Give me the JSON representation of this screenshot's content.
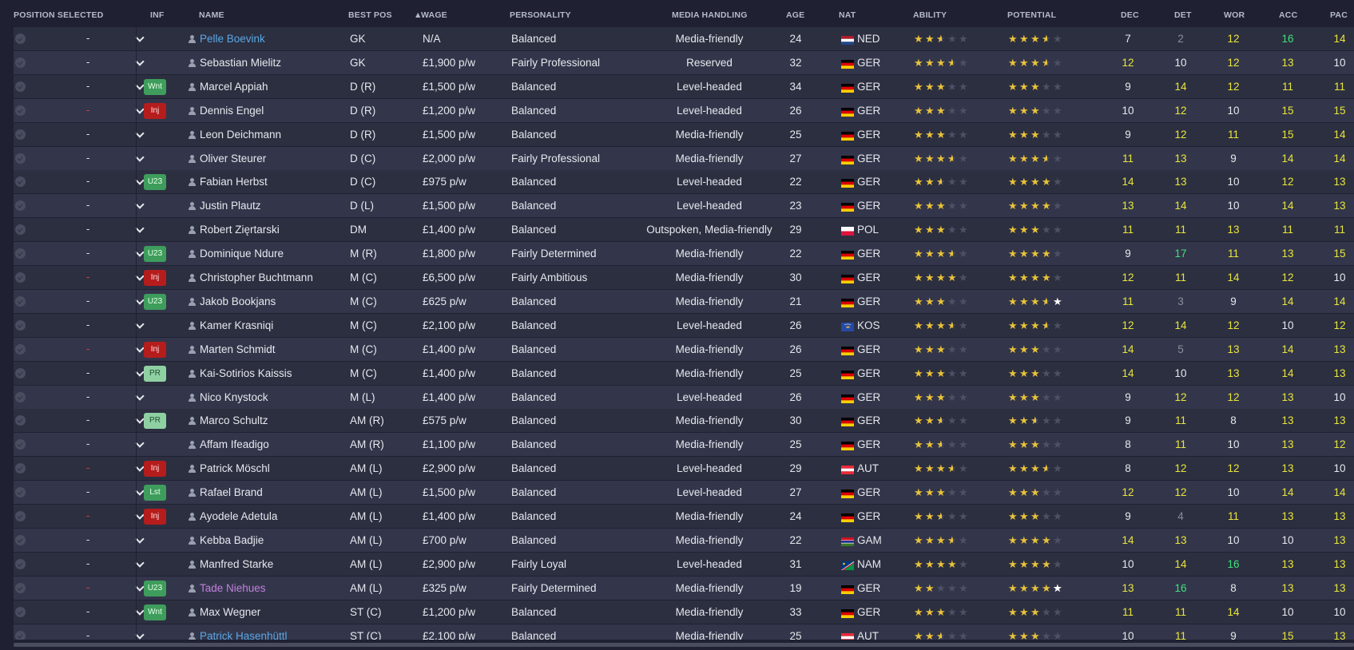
{
  "columns": {
    "position_selected": "POSITION SELECTED",
    "inf": "INF",
    "name": "NAME",
    "best_pos": "BEST POS",
    "wage": "WAGE",
    "personality": "PERSONALITY",
    "media_handling": "MEDIA HANDLING",
    "age": "AGE",
    "nat": "NAT",
    "ability": "ABILITY",
    "potential": "POTENTIAL",
    "dec": "DEC",
    "det": "DET",
    "wor": "WOR",
    "acc": "ACC",
    "pac": "PAC"
  },
  "sort_indicator": "▲",
  "colors": {
    "attr_white": "#e6e8ee",
    "attr_yellow": "#e8e63a",
    "attr_green": "#3fe07a",
    "attr_grey": "#8a8e9c",
    "star_gold": "#e8c23a",
    "star_empty": "#4e5163"
  },
  "players": [
    {
      "pos_sel": "-",
      "pos_red": false,
      "inf": "",
      "inf_type": "",
      "name": "Pelle Boevink",
      "name_color": "blue",
      "best_pos": "GK",
      "wage": "N/A",
      "personality": "Balanced",
      "media": "Media-friendly",
      "age": "24",
      "nat": "NED",
      "flag": "NED",
      "ability": 2.5,
      "potential": 3.5,
      "dec": "7",
      "dec_c": "white",
      "det": "2",
      "det_c": "grey",
      "wor": "12",
      "wor_c": "yellow",
      "acc": "16",
      "acc_c": "green",
      "pac": "14",
      "pac_c": "yellow"
    },
    {
      "pos_sel": "-",
      "pos_red": false,
      "inf": "",
      "inf_type": "",
      "name": "Sebastian Mielitz",
      "name_color": "white",
      "best_pos": "GK",
      "wage": "£1,900 p/w",
      "personality": "Fairly Professional",
      "media": "Reserved",
      "age": "32",
      "nat": "GER",
      "flag": "GER",
      "ability": 3.5,
      "potential": 3.5,
      "dec": "12",
      "dec_c": "yellow",
      "det": "10",
      "det_c": "white",
      "wor": "12",
      "wor_c": "yellow",
      "acc": "13",
      "acc_c": "yellow",
      "pac": "10",
      "pac_c": "white"
    },
    {
      "pos_sel": "-",
      "pos_red": false,
      "inf": "Wnt",
      "inf_type": "green",
      "name": "Marcel Appiah",
      "name_color": "white",
      "best_pos": "D (R)",
      "wage": "£1,500 p/w",
      "personality": "Balanced",
      "media": "Level-headed",
      "age": "34",
      "nat": "GER",
      "flag": "GER",
      "ability": 3,
      "potential": 3,
      "dec": "9",
      "dec_c": "white",
      "det": "14",
      "det_c": "yellow",
      "wor": "12",
      "wor_c": "yellow",
      "acc": "11",
      "acc_c": "yellow",
      "pac": "11",
      "pac_c": "yellow"
    },
    {
      "pos_sel": "-",
      "pos_red": true,
      "inf": "Inj",
      "inf_type": "red",
      "name": "Dennis Engel",
      "name_color": "white",
      "best_pos": "D (R)",
      "wage": "£1,200 p/w",
      "personality": "Balanced",
      "media": "Level-headed",
      "age": "26",
      "nat": "GER",
      "flag": "GER",
      "ability": 3,
      "potential": 3,
      "dec": "10",
      "dec_c": "white",
      "det": "12",
      "det_c": "yellow",
      "wor": "10",
      "wor_c": "white",
      "acc": "15",
      "acc_c": "yellow",
      "pac": "15",
      "pac_c": "yellow"
    },
    {
      "pos_sel": "-",
      "pos_red": false,
      "inf": "",
      "inf_type": "",
      "name": "Leon Deichmann",
      "name_color": "white",
      "best_pos": "D (R)",
      "wage": "£1,500 p/w",
      "personality": "Balanced",
      "media": "Media-friendly",
      "age": "25",
      "nat": "GER",
      "flag": "GER",
      "ability": 3,
      "potential": 3,
      "dec": "9",
      "dec_c": "white",
      "det": "12",
      "det_c": "yellow",
      "wor": "11",
      "wor_c": "yellow",
      "acc": "15",
      "acc_c": "yellow",
      "pac": "14",
      "pac_c": "yellow"
    },
    {
      "pos_sel": "-",
      "pos_red": false,
      "inf": "",
      "inf_type": "",
      "name": "Oliver Steurer",
      "name_color": "white",
      "best_pos": "D (C)",
      "wage": "£2,000 p/w",
      "personality": "Fairly Professional",
      "media": "Media-friendly",
      "age": "27",
      "nat": "GER",
      "flag": "GER",
      "ability": 3.5,
      "potential": 3.5,
      "dec": "11",
      "dec_c": "yellow",
      "det": "13",
      "det_c": "yellow",
      "wor": "9",
      "wor_c": "white",
      "acc": "14",
      "acc_c": "yellow",
      "pac": "14",
      "pac_c": "yellow"
    },
    {
      "pos_sel": "-",
      "pos_red": false,
      "inf": "U23",
      "inf_type": "green",
      "name": "Fabian Herbst",
      "name_color": "white",
      "best_pos": "D (C)",
      "wage": "£975 p/w",
      "personality": "Balanced",
      "media": "Level-headed",
      "age": "22",
      "nat": "GER",
      "flag": "GER",
      "ability": 2.5,
      "potential": 4,
      "dec": "14",
      "dec_c": "yellow",
      "det": "13",
      "det_c": "yellow",
      "wor": "10",
      "wor_c": "white",
      "acc": "12",
      "acc_c": "yellow",
      "pac": "13",
      "pac_c": "yellow"
    },
    {
      "pos_sel": "-",
      "pos_red": false,
      "inf": "",
      "inf_type": "",
      "name": "Justin Plautz",
      "name_color": "white",
      "best_pos": "D (L)",
      "wage": "£1,500 p/w",
      "personality": "Balanced",
      "media": "Level-headed",
      "age": "23",
      "nat": "GER",
      "flag": "GER",
      "ability": 3,
      "potential": 4,
      "dec": "13",
      "dec_c": "yellow",
      "det": "14",
      "det_c": "yellow",
      "wor": "10",
      "wor_c": "white",
      "acc": "14",
      "acc_c": "yellow",
      "pac": "13",
      "pac_c": "yellow"
    },
    {
      "pos_sel": "-",
      "pos_red": false,
      "inf": "",
      "inf_type": "",
      "name": "Robert Zięrtarski",
      "name_color": "white",
      "best_pos": "DM",
      "wage": "£1,400 p/w",
      "personality": "Balanced",
      "media": "Outspoken, Media-friendly",
      "age": "29",
      "nat": "POL",
      "flag": "POL",
      "ability": 3,
      "potential": 3,
      "dec": "11",
      "dec_c": "yellow",
      "det": "11",
      "det_c": "yellow",
      "wor": "13",
      "wor_c": "yellow",
      "acc": "11",
      "acc_c": "yellow",
      "pac": "11",
      "pac_c": "yellow"
    },
    {
      "pos_sel": "-",
      "pos_red": false,
      "inf": "U23",
      "inf_type": "green",
      "name": "Dominique Ndure",
      "name_color": "white",
      "best_pos": "M (R)",
      "wage": "£1,800 p/w",
      "personality": "Fairly Determined",
      "media": "Media-friendly",
      "age": "22",
      "nat": "GER",
      "flag": "GER",
      "ability": 3.5,
      "potential": 4,
      "dec": "9",
      "dec_c": "white",
      "det": "17",
      "det_c": "green",
      "wor": "11",
      "wor_c": "yellow",
      "acc": "13",
      "acc_c": "yellow",
      "pac": "15",
      "pac_c": "yellow"
    },
    {
      "pos_sel": "-",
      "pos_red": true,
      "inf": "Inj",
      "inf_type": "red",
      "name": "Christopher Buchtmann",
      "name_color": "white",
      "best_pos": "M (C)",
      "wage": "£6,500 p/w",
      "personality": "Fairly Ambitious",
      "media": "Media-friendly",
      "age": "30",
      "nat": "GER",
      "flag": "GER",
      "ability": 4,
      "potential": 4,
      "dec": "12",
      "dec_c": "yellow",
      "det": "11",
      "det_c": "yellow",
      "wor": "14",
      "wor_c": "yellow",
      "acc": "12",
      "acc_c": "yellow",
      "pac": "10",
      "pac_c": "white"
    },
    {
      "pos_sel": "-",
      "pos_red": false,
      "inf": "U23",
      "inf_type": "green",
      "name": "Jakob Bookjans",
      "name_color": "white",
      "best_pos": "M (C)",
      "wage": "£625 p/w",
      "personality": "Balanced",
      "media": "Media-friendly",
      "age": "21",
      "nat": "GER",
      "flag": "GER",
      "ability": 3,
      "potential": 3.5,
      "potential_range": true,
      "dec": "11",
      "dec_c": "yellow",
      "det": "3",
      "det_c": "grey",
      "wor": "9",
      "wor_c": "white",
      "acc": "14",
      "acc_c": "yellow",
      "pac": "14",
      "pac_c": "yellow"
    },
    {
      "pos_sel": "-",
      "pos_red": false,
      "inf": "",
      "inf_type": "",
      "name": "Kamer Krasniqi",
      "name_color": "white",
      "best_pos": "M (C)",
      "wage": "£2,100 p/w",
      "personality": "Balanced",
      "media": "Level-headed",
      "age": "26",
      "nat": "KOS",
      "flag": "KOS",
      "ability": 3.5,
      "potential": 3.5,
      "dec": "12",
      "dec_c": "yellow",
      "det": "14",
      "det_c": "yellow",
      "wor": "12",
      "wor_c": "yellow",
      "acc": "10",
      "acc_c": "white",
      "pac": "12",
      "pac_c": "yellow"
    },
    {
      "pos_sel": "-",
      "pos_red": true,
      "inf": "Inj",
      "inf_type": "red",
      "name": "Marten Schmidt",
      "name_color": "white",
      "best_pos": "M (C)",
      "wage": "£1,400 p/w",
      "personality": "Balanced",
      "media": "Media-friendly",
      "age": "26",
      "nat": "GER",
      "flag": "GER",
      "ability": 3,
      "potential": 3,
      "dec": "14",
      "dec_c": "yellow",
      "det": "5",
      "det_c": "grey",
      "wor": "13",
      "wor_c": "yellow",
      "acc": "14",
      "acc_c": "yellow",
      "pac": "13",
      "pac_c": "yellow"
    },
    {
      "pos_sel": "-",
      "pos_red": false,
      "inf": "PR",
      "inf_type": "pale",
      "name": "Kai-Sotirios Kaissis",
      "name_color": "white",
      "best_pos": "M (C)",
      "wage": "£1,400 p/w",
      "personality": "Balanced",
      "media": "Media-friendly",
      "age": "25",
      "nat": "GER",
      "flag": "GER",
      "ability": 3,
      "potential": 3,
      "dec": "14",
      "dec_c": "yellow",
      "det": "10",
      "det_c": "white",
      "wor": "13",
      "wor_c": "yellow",
      "acc": "14",
      "acc_c": "yellow",
      "pac": "13",
      "pac_c": "yellow"
    },
    {
      "pos_sel": "-",
      "pos_red": false,
      "inf": "",
      "inf_type": "",
      "name": "Nico Knystock",
      "name_color": "white",
      "best_pos": "M (L)",
      "wage": "£1,400 p/w",
      "personality": "Balanced",
      "media": "Level-headed",
      "age": "26",
      "nat": "GER",
      "flag": "GER",
      "ability": 3,
      "potential": 3,
      "dec": "9",
      "dec_c": "white",
      "det": "12",
      "det_c": "yellow",
      "wor": "12",
      "wor_c": "yellow",
      "acc": "13",
      "acc_c": "yellow",
      "pac": "10",
      "pac_c": "white"
    },
    {
      "pos_sel": "-",
      "pos_red": false,
      "inf": "PR",
      "inf_type": "pale",
      "name": "Marco Schultz",
      "name_color": "white",
      "best_pos": "AM (R)",
      "wage": "£575 p/w",
      "personality": "Balanced",
      "media": "Media-friendly",
      "age": "30",
      "nat": "GER",
      "flag": "GER",
      "ability": 2.5,
      "potential": 2.5,
      "dec": "9",
      "dec_c": "white",
      "det": "11",
      "det_c": "yellow",
      "wor": "8",
      "wor_c": "white",
      "acc": "13",
      "acc_c": "yellow",
      "pac": "13",
      "pac_c": "yellow"
    },
    {
      "pos_sel": "-",
      "pos_red": false,
      "inf": "",
      "inf_type": "",
      "name": "Affam Ifeadigo",
      "name_color": "white",
      "best_pos": "AM (R)",
      "wage": "£1,100 p/w",
      "personality": "Balanced",
      "media": "Media-friendly",
      "age": "25",
      "nat": "GER",
      "flag": "GER",
      "ability": 2.5,
      "potential": 3,
      "dec": "8",
      "dec_c": "white",
      "det": "11",
      "det_c": "yellow",
      "wor": "10",
      "wor_c": "white",
      "acc": "13",
      "acc_c": "yellow",
      "pac": "12",
      "pac_c": "yellow"
    },
    {
      "pos_sel": "-",
      "pos_red": true,
      "inf": "Inj",
      "inf_type": "red",
      "name": "Patrick Möschl",
      "name_color": "white",
      "best_pos": "AM (L)",
      "wage": "£2,900 p/w",
      "personality": "Balanced",
      "media": "Level-headed",
      "age": "29",
      "nat": "AUT",
      "flag": "AUT",
      "ability": 3.5,
      "potential": 3.5,
      "dec": "8",
      "dec_c": "white",
      "det": "12",
      "det_c": "yellow",
      "wor": "12",
      "wor_c": "yellow",
      "acc": "13",
      "acc_c": "yellow",
      "pac": "10",
      "pac_c": "white"
    },
    {
      "pos_sel": "-",
      "pos_red": false,
      "inf": "Lst",
      "inf_type": "green",
      "name": "Rafael Brand",
      "name_color": "white",
      "best_pos": "AM (L)",
      "wage": "£1,500 p/w",
      "personality": "Balanced",
      "media": "Level-headed",
      "age": "27",
      "nat": "GER",
      "flag": "GER",
      "ability": 3,
      "potential": 3,
      "dec": "12",
      "dec_c": "yellow",
      "det": "12",
      "det_c": "yellow",
      "wor": "10",
      "wor_c": "white",
      "acc": "14",
      "acc_c": "yellow",
      "pac": "14",
      "pac_c": "yellow"
    },
    {
      "pos_sel": "-",
      "pos_red": true,
      "inf": "Inj",
      "inf_type": "red",
      "name": "Ayodele Adetula",
      "name_color": "white",
      "best_pos": "AM (L)",
      "wage": "£1,400 p/w",
      "personality": "Balanced",
      "media": "Media-friendly",
      "age": "24",
      "nat": "GER",
      "flag": "GER",
      "ability": 2.5,
      "potential": 3,
      "dec": "9",
      "dec_c": "white",
      "det": "4",
      "det_c": "grey",
      "wor": "11",
      "wor_c": "yellow",
      "acc": "13",
      "acc_c": "yellow",
      "pac": "13",
      "pac_c": "yellow"
    },
    {
      "pos_sel": "-",
      "pos_red": false,
      "inf": "",
      "inf_type": "",
      "name": "Kebba Badjie",
      "name_color": "white",
      "best_pos": "AM (L)",
      "wage": "£700 p/w",
      "personality": "Balanced",
      "media": "Media-friendly",
      "age": "22",
      "nat": "GAM",
      "flag": "GAM",
      "ability": 3.5,
      "potential": 4,
      "dec": "14",
      "dec_c": "yellow",
      "det": "13",
      "det_c": "yellow",
      "wor": "10",
      "wor_c": "white",
      "acc": "10",
      "acc_c": "white",
      "pac": "13",
      "pac_c": "yellow"
    },
    {
      "pos_sel": "-",
      "pos_red": false,
      "inf": "",
      "inf_type": "",
      "name": "Manfred Starke",
      "name_color": "white",
      "best_pos": "AM (L)",
      "wage": "£2,900 p/w",
      "personality": "Fairly Loyal",
      "media": "Level-headed",
      "age": "31",
      "nat": "NAM",
      "flag": "NAM",
      "ability": 4,
      "potential": 4,
      "dec": "10",
      "dec_c": "white",
      "det": "14",
      "det_c": "yellow",
      "wor": "16",
      "wor_c": "green",
      "acc": "13",
      "acc_c": "yellow",
      "pac": "13",
      "pac_c": "yellow"
    },
    {
      "pos_sel": "-",
      "pos_red": true,
      "inf": "U23",
      "inf_type": "green",
      "name": "Tade Niehues",
      "name_color": "purple",
      "best_pos": "AM (L)",
      "wage": "£325 p/w",
      "personality": "Fairly Determined",
      "media": "Media-friendly",
      "age": "19",
      "nat": "GER",
      "flag": "GER",
      "ability": 2,
      "potential": 4,
      "potential_range": true,
      "dec": "13",
      "dec_c": "yellow",
      "det": "16",
      "det_c": "green",
      "wor": "8",
      "wor_c": "white",
      "acc": "13",
      "acc_c": "yellow",
      "pac": "13",
      "pac_c": "yellow"
    },
    {
      "pos_sel": "-",
      "pos_red": false,
      "inf": "Wnt",
      "inf_type": "green",
      "name": "Max Wegner",
      "name_color": "white",
      "best_pos": "ST (C)",
      "wage": "£1,200 p/w",
      "personality": "Balanced",
      "media": "Media-friendly",
      "age": "33",
      "nat": "GER",
      "flag": "GER",
      "ability": 3,
      "potential": 3,
      "dec": "11",
      "dec_c": "yellow",
      "det": "11",
      "det_c": "yellow",
      "wor": "14",
      "wor_c": "yellow",
      "acc": "10",
      "acc_c": "white",
      "pac": "10",
      "pac_c": "white"
    },
    {
      "pos_sel": "-",
      "pos_red": false,
      "inf": "",
      "inf_type": "",
      "name": "Patrick Hasenhüttl",
      "name_color": "blue",
      "best_pos": "ST (C)",
      "wage": "£2,100 p/w",
      "personality": "Balanced",
      "media": "Media-friendly",
      "age": "25",
      "nat": "AUT",
      "flag": "AUT",
      "ability": 2.5,
      "potential": 3,
      "dec": "10",
      "dec_c": "white",
      "det": "11",
      "det_c": "yellow",
      "wor": "9",
      "wor_c": "white",
      "acc": "15",
      "acc_c": "yellow",
      "pac": "13",
      "pac_c": "yellow"
    }
  ]
}
